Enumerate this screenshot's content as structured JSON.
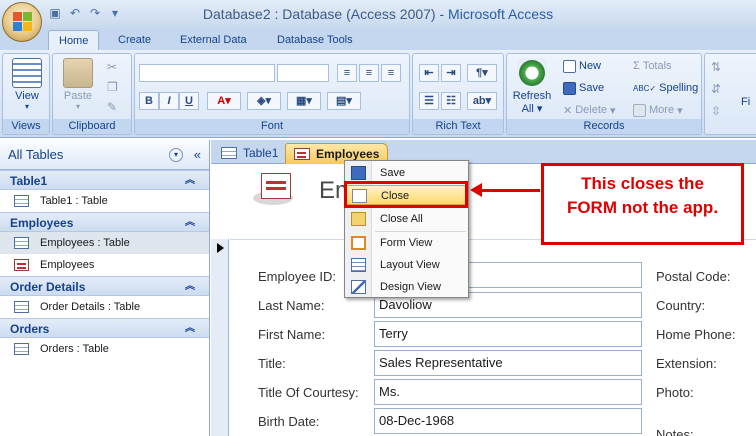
{
  "window": {
    "title_doc": "Database2 : Database (Access 2007) - ",
    "title_app": "Microsoft Access"
  },
  "quick_access": {
    "save_icon": "floppy-disk-icon",
    "undo_icon": "undo-icon",
    "redo_icon": "redo-icon"
  },
  "ribbon_tabs": [
    "Home",
    "Create",
    "External Data",
    "Database Tools"
  ],
  "ribbon": {
    "views_label": "Views",
    "view_button": "View",
    "clipboard_label": "Clipboard",
    "paste_button": "Paste",
    "font_label": "Font",
    "richtext_label": "Rich Text",
    "records_label": "Records",
    "refresh_button": "Refresh",
    "refresh_sub": "All",
    "new_button": "New",
    "save_button": "Save",
    "delete_button": "Delete",
    "totals_button": "Totals",
    "spelling_button": "Spelling",
    "more_button": "More",
    "find_partial": "Fi"
  },
  "nav": {
    "header": "All Tables",
    "groups": [
      {
        "name": "Table1",
        "items": [
          {
            "label": "Table1 : Table",
            "type": "table"
          }
        ]
      },
      {
        "name": "Employees",
        "items": [
          {
            "label": "Employees : Table",
            "type": "table"
          },
          {
            "label": "Employees",
            "type": "form"
          }
        ]
      },
      {
        "name": "Order Details",
        "items": [
          {
            "label": "Order Details : Table",
            "type": "table"
          }
        ]
      },
      {
        "name": "Orders",
        "items": [
          {
            "label": "Orders : Table",
            "type": "table"
          }
        ]
      }
    ]
  },
  "doc_tabs": {
    "table1": "Table1",
    "employees": "Employees"
  },
  "form": {
    "title_partial": "Em",
    "fields": {
      "employee_id_label": "Employee ID:",
      "last_name_label": "Last Name:",
      "last_name_value": "Davoliow",
      "first_name_label": "First Name:",
      "first_name_value": "Terry",
      "title_label": "Title:",
      "title_value": "Sales Representative",
      "courtesy_label": "Title Of Courtesy:",
      "courtesy_value": "Ms.",
      "birth_date_label": "Birth Date:",
      "birth_date_value": "08-Dec-1968",
      "postal_code_label": "Postal Code:",
      "country_label": "Country:",
      "home_phone_label": "Home Phone:",
      "extension_label": "Extension:",
      "photo_label": "Photo:",
      "notes_label": "Notes:"
    }
  },
  "context_menu": {
    "save": "Save",
    "close": "Close",
    "close_all": "Close All",
    "form_view": "Form View",
    "layout_view": "Layout View",
    "design_view": "Design View"
  },
  "annotation": {
    "line1": "This closes the",
    "line2": "FORM not the app."
  },
  "colors": {
    "annotation_red": "#e00000",
    "active_doc_tab": "#f8c95d",
    "ribbon_text": "#15428b"
  }
}
